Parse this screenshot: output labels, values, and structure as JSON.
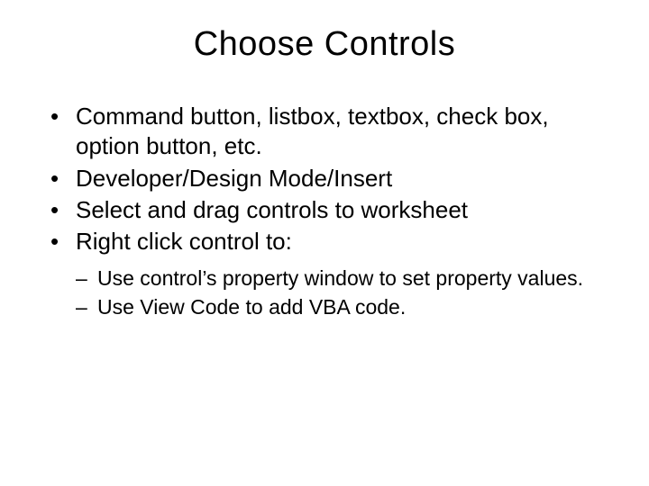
{
  "slide": {
    "title": "Choose Controls",
    "bullets": [
      "Command button, listbox, textbox, check box, option button, etc.",
      "Developer/Design Mode/Insert",
      "Select and drag controls to worksheet",
      "Right click control to:"
    ],
    "subbullets": [
      "Use control’s property window to set property values.",
      "Use View Code to add VBA code."
    ]
  }
}
